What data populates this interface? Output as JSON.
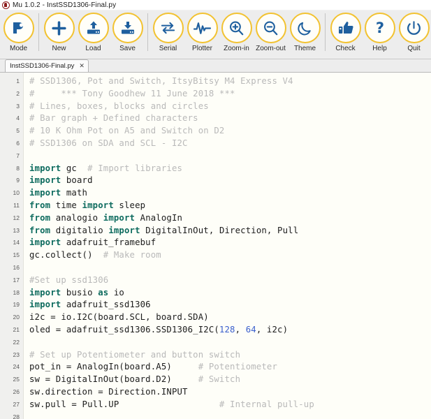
{
  "window": {
    "app_name": "Mu",
    "version": "1.0.2",
    "title": "Mu 1.0.2 - InstSSD1306-Final.py",
    "logo_icon": "mu-logo-icon"
  },
  "toolbar": {
    "buttons": [
      {
        "label": "Mode",
        "icon": "mode-icon",
        "name": "mode-button"
      },
      {
        "label": "New",
        "icon": "plus-icon",
        "name": "new-button"
      },
      {
        "label": "Load",
        "icon": "upload-icon",
        "name": "load-button"
      },
      {
        "label": "Save",
        "icon": "download-icon",
        "name": "save-button"
      },
      {
        "label": "Serial",
        "icon": "arrows-icon",
        "name": "serial-button"
      },
      {
        "label": "Plotter",
        "icon": "waveform-icon",
        "name": "plotter-button"
      },
      {
        "label": "Zoom-in",
        "icon": "zoom-in-icon",
        "name": "zoom-in-button"
      },
      {
        "label": "Zoom-out",
        "icon": "zoom-out-icon",
        "name": "zoom-out-button"
      },
      {
        "label": "Theme",
        "icon": "moon-icon",
        "name": "theme-button"
      },
      {
        "label": "Check",
        "icon": "thumbs-up-icon",
        "name": "check-button"
      },
      {
        "label": "Help",
        "icon": "question-icon",
        "name": "help-button"
      },
      {
        "label": "Quit",
        "icon": "power-icon",
        "name": "quit-button"
      }
    ],
    "ring_color": "#f2c230",
    "icon_color": "#1e5f9e"
  },
  "tabs": [
    {
      "label": "InstSSD1306-Final.py",
      "close_label": "✕",
      "active": true
    }
  ],
  "editor": {
    "first_line": 1,
    "last_line": 28,
    "colors": {
      "background": "#fefef8",
      "gutter": "#f0f0ee",
      "comment": "#b9b9b9",
      "keyword": "#0d6b5e",
      "number": "#3a5fcd",
      "text": "#1c1c1c"
    },
    "lines": [
      {
        "n": 1,
        "tokens": [
          {
            "t": "cmt",
            "s": "# SSD1306, Pot and Switch, ItsyBitsy M4 Express V4"
          }
        ]
      },
      {
        "n": 2,
        "tokens": [
          {
            "t": "cmt",
            "s": "#     *** Tony Goodhew 11 June 2018 ***"
          }
        ]
      },
      {
        "n": 3,
        "tokens": [
          {
            "t": "cmt",
            "s": "# Lines, boxes, blocks and circles"
          }
        ]
      },
      {
        "n": 4,
        "tokens": [
          {
            "t": "cmt",
            "s": "# Bar graph + Defined characters"
          }
        ]
      },
      {
        "n": 5,
        "tokens": [
          {
            "t": "cmt",
            "s": "# 10 K Ohm Pot on A5 and Switch on D2"
          }
        ]
      },
      {
        "n": 6,
        "tokens": [
          {
            "t": "cmt",
            "s": "# SSD1306 on SDA and SCL - I2C"
          }
        ]
      },
      {
        "n": 7,
        "tokens": []
      },
      {
        "n": 8,
        "tokens": [
          {
            "t": "kw",
            "s": "import"
          },
          {
            "t": "txt",
            "s": " gc  "
          },
          {
            "t": "cmt",
            "s": "# Import libraries"
          }
        ]
      },
      {
        "n": 9,
        "tokens": [
          {
            "t": "kw",
            "s": "import"
          },
          {
            "t": "txt",
            "s": " board"
          }
        ]
      },
      {
        "n": 10,
        "tokens": [
          {
            "t": "kw",
            "s": "import"
          },
          {
            "t": "txt",
            "s": " math"
          }
        ]
      },
      {
        "n": 11,
        "tokens": [
          {
            "t": "kw",
            "s": "from"
          },
          {
            "t": "txt",
            "s": " time "
          },
          {
            "t": "kw",
            "s": "import"
          },
          {
            "t": "txt",
            "s": " sleep"
          }
        ]
      },
      {
        "n": 12,
        "tokens": [
          {
            "t": "kw",
            "s": "from"
          },
          {
            "t": "txt",
            "s": " analogio "
          },
          {
            "t": "kw",
            "s": "import"
          },
          {
            "t": "txt",
            "s": " AnalogIn"
          }
        ]
      },
      {
        "n": 13,
        "tokens": [
          {
            "t": "kw",
            "s": "from"
          },
          {
            "t": "txt",
            "s": " digitalio "
          },
          {
            "t": "kw",
            "s": "import"
          },
          {
            "t": "txt",
            "s": " DigitalInOut, Direction, Pull"
          }
        ]
      },
      {
        "n": 14,
        "tokens": [
          {
            "t": "kw",
            "s": "import"
          },
          {
            "t": "txt",
            "s": " adafruit_framebuf"
          }
        ]
      },
      {
        "n": 15,
        "tokens": [
          {
            "t": "txt",
            "s": "gc.collect()  "
          },
          {
            "t": "cmt",
            "s": "# Make room"
          }
        ]
      },
      {
        "n": 16,
        "tokens": []
      },
      {
        "n": 17,
        "tokens": [
          {
            "t": "cmt",
            "s": "#Set up ssd1306"
          }
        ]
      },
      {
        "n": 18,
        "tokens": [
          {
            "t": "kw",
            "s": "import"
          },
          {
            "t": "txt",
            "s": " busio "
          },
          {
            "t": "kw",
            "s": "as"
          },
          {
            "t": "txt",
            "s": " io"
          }
        ]
      },
      {
        "n": 19,
        "tokens": [
          {
            "t": "kw",
            "s": "import"
          },
          {
            "t": "txt",
            "s": " adafruit_ssd1306"
          }
        ]
      },
      {
        "n": 20,
        "tokens": [
          {
            "t": "txt",
            "s": "i2c = io.I2C(board.SCL, board.SDA)"
          }
        ]
      },
      {
        "n": 21,
        "tokens": [
          {
            "t": "txt",
            "s": "oled = adafruit_ssd1306.SSD1306_I2C("
          },
          {
            "t": "num",
            "s": "128"
          },
          {
            "t": "txt",
            "s": ", "
          },
          {
            "t": "num",
            "s": "64"
          },
          {
            "t": "txt",
            "s": ", i2c)"
          }
        ]
      },
      {
        "n": 22,
        "tokens": []
      },
      {
        "n": 23,
        "tokens": [
          {
            "t": "cmt",
            "s": "# Set up Potentiometer and button switch"
          }
        ]
      },
      {
        "n": 24,
        "tokens": [
          {
            "t": "txt",
            "s": "pot_in = AnalogIn(board.A5)     "
          },
          {
            "t": "cmt",
            "s": "# Potentiometer"
          }
        ]
      },
      {
        "n": 25,
        "tokens": [
          {
            "t": "txt",
            "s": "sw = DigitalInOut(board.D2)     "
          },
          {
            "t": "cmt",
            "s": "# Switch"
          }
        ]
      },
      {
        "n": 26,
        "tokens": [
          {
            "t": "txt",
            "s": "sw.direction = Direction.INPUT"
          }
        ]
      },
      {
        "n": 27,
        "tokens": [
          {
            "t": "txt",
            "s": "sw.pull = Pull.UP                   "
          },
          {
            "t": "cmt",
            "s": "# Internal pull-up"
          }
        ]
      },
      {
        "n": 28,
        "tokens": []
      }
    ]
  }
}
